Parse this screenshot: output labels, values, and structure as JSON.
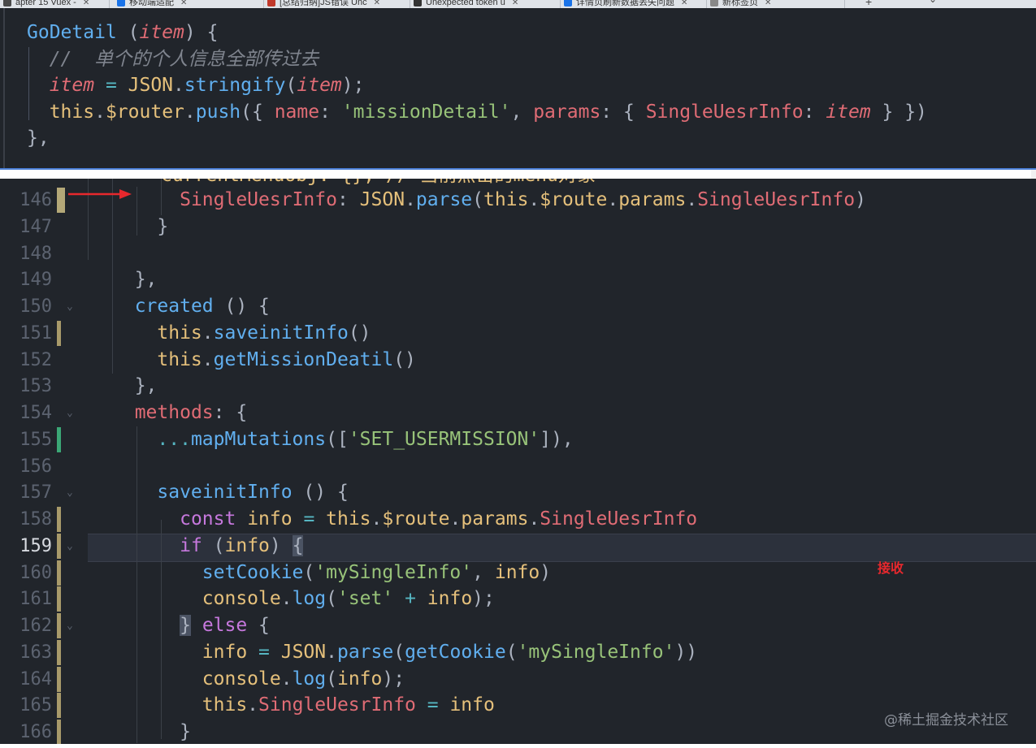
{
  "browser_tabs": [
    {
      "label": "apter 15 Vuex -",
      "color": "#4a4a4a"
    },
    {
      "label": "移动端适配",
      "color": "#1a73e8"
    },
    {
      "label": "[总结归纳]JS错误 Unc",
      "color": "#c0392b"
    },
    {
      "label": "Unexpected token u",
      "color": "#333333"
    },
    {
      "label": "详情页刷新数据丢失问题",
      "color": "#1a73e8"
    },
    {
      "label": "新标签页",
      "color": "#888888"
    }
  ],
  "top_snippet": {
    "lines": [
      [
        {
          "t": "GoDetail",
          "c": "f"
        },
        {
          "t": " (",
          "c": "t"
        },
        {
          "t": "item",
          "c": "pi"
        },
        {
          "t": ") {",
          "c": "t"
        }
      ],
      [
        {
          "t": "  //  单个的个人信息全部传过去",
          "c": "c"
        }
      ],
      [
        {
          "t": "  ",
          "c": "t"
        },
        {
          "t": "item",
          "c": "pi"
        },
        {
          "t": " = ",
          "c": "o"
        },
        {
          "t": "JSON",
          "c": "y"
        },
        {
          "t": ".",
          "c": "t"
        },
        {
          "t": "stringify",
          "c": "f"
        },
        {
          "t": "(",
          "c": "t"
        },
        {
          "t": "item",
          "c": "pi"
        },
        {
          "t": ");",
          "c": "t"
        }
      ],
      [
        {
          "t": "  ",
          "c": "t"
        },
        {
          "t": "this",
          "c": "y"
        },
        {
          "t": ".",
          "c": "t"
        },
        {
          "t": "$router",
          "c": "y"
        },
        {
          "t": ".",
          "c": "t"
        },
        {
          "t": "push",
          "c": "f"
        },
        {
          "t": "({ ",
          "c": "t"
        },
        {
          "t": "name",
          "c": "p"
        },
        {
          "t": ": ",
          "c": "t"
        },
        {
          "t": "'missionDetail'",
          "c": "s"
        },
        {
          "t": ", ",
          "c": "t"
        },
        {
          "t": "params",
          "c": "p"
        },
        {
          "t": ": { ",
          "c": "t"
        },
        {
          "t": "SingleUesrInfo",
          "c": "p"
        },
        {
          "t": ": ",
          "c": "t"
        },
        {
          "t": "item",
          "c": "pi"
        },
        {
          "t": " } })",
          "c": "t"
        }
      ],
      [
        {
          "t": "},",
          "c": "t"
        }
      ]
    ]
  },
  "cut_off_line": "currentMenuobj: {}, // 当前点击的menu对象",
  "editor": {
    "lines": [
      {
        "num": "146",
        "marker": "big",
        "fold": false,
        "active": false,
        "segments": [
          {
            "t": "      ",
            "c": "t"
          },
          {
            "t": "SingleUesrInfo",
            "c": "p"
          },
          {
            "t": ": ",
            "c": "t"
          },
          {
            "t": "JSON",
            "c": "y"
          },
          {
            "t": ".",
            "c": "t"
          },
          {
            "t": "parse",
            "c": "f"
          },
          {
            "t": "(",
            "c": "t"
          },
          {
            "t": "this",
            "c": "y"
          },
          {
            "t": ".",
            "c": "t"
          },
          {
            "t": "$route",
            "c": "y"
          },
          {
            "t": ".",
            "c": "t"
          },
          {
            "t": "params",
            "c": "y"
          },
          {
            "t": ".",
            "c": "t"
          },
          {
            "t": "SingleUesrInfo",
            "c": "p"
          },
          {
            "t": ")",
            "c": "t"
          }
        ]
      },
      {
        "num": "147",
        "marker": "",
        "fold": false,
        "active": false,
        "segments": [
          {
            "t": "    }",
            "c": "t"
          }
        ]
      },
      {
        "num": "148",
        "marker": "",
        "fold": false,
        "active": false,
        "segments": []
      },
      {
        "num": "149",
        "marker": "",
        "fold": false,
        "active": false,
        "segments": [
          {
            "t": "  },",
            "c": "t"
          }
        ]
      },
      {
        "num": "150",
        "marker": "",
        "fold": true,
        "active": false,
        "segments": [
          {
            "t": "  ",
            "c": "t"
          },
          {
            "t": "created",
            "c": "f"
          },
          {
            "t": " () {",
            "c": "t"
          }
        ]
      },
      {
        "num": "151",
        "marker": "mod",
        "fold": false,
        "active": false,
        "segments": [
          {
            "t": "    ",
            "c": "t"
          },
          {
            "t": "this",
            "c": "y"
          },
          {
            "t": ".",
            "c": "t"
          },
          {
            "t": "saveinitInfo",
            "c": "f"
          },
          {
            "t": "()",
            "c": "t"
          }
        ]
      },
      {
        "num": "152",
        "marker": "",
        "fold": false,
        "active": false,
        "segments": [
          {
            "t": "    ",
            "c": "t"
          },
          {
            "t": "this",
            "c": "y"
          },
          {
            "t": ".",
            "c": "t"
          },
          {
            "t": "getMissionDeatil",
            "c": "f"
          },
          {
            "t": "()",
            "c": "t"
          }
        ]
      },
      {
        "num": "153",
        "marker": "",
        "fold": false,
        "active": false,
        "segments": [
          {
            "t": "  },",
            "c": "t"
          }
        ]
      },
      {
        "num": "154",
        "marker": "",
        "fold": true,
        "active": false,
        "segments": [
          {
            "t": "  ",
            "c": "t"
          },
          {
            "t": "methods",
            "c": "p"
          },
          {
            "t": ": {",
            "c": "t"
          }
        ]
      },
      {
        "num": "155",
        "marker": "add",
        "fold": false,
        "active": false,
        "segments": [
          {
            "t": "    ",
            "c": "t"
          },
          {
            "t": "...",
            "c": "o"
          },
          {
            "t": "mapMutations",
            "c": "f"
          },
          {
            "t": "([",
            "c": "t"
          },
          {
            "t": "'SET_USERMISSION'",
            "c": "s"
          },
          {
            "t": "]),",
            "c": "t"
          }
        ]
      },
      {
        "num": "156",
        "marker": "",
        "fold": false,
        "active": false,
        "segments": []
      },
      {
        "num": "157",
        "marker": "",
        "fold": true,
        "active": false,
        "segments": [
          {
            "t": "    ",
            "c": "t"
          },
          {
            "t": "saveinitInfo",
            "c": "f"
          },
          {
            "t": " () {",
            "c": "t"
          }
        ]
      },
      {
        "num": "158",
        "marker": "mod",
        "fold": false,
        "active": false,
        "segments": [
          {
            "t": "      ",
            "c": "t"
          },
          {
            "t": "const",
            "c": "k"
          },
          {
            "t": " ",
            "c": "t"
          },
          {
            "t": "info",
            "c": "y"
          },
          {
            "t": " = ",
            "c": "o"
          },
          {
            "t": "this",
            "c": "y"
          },
          {
            "t": ".",
            "c": "t"
          },
          {
            "t": "$route",
            "c": "y"
          },
          {
            "t": ".",
            "c": "t"
          },
          {
            "t": "params",
            "c": "y"
          },
          {
            "t": ".",
            "c": "t"
          },
          {
            "t": "SingleUesrInfo",
            "c": "p"
          }
        ]
      },
      {
        "num": "159",
        "marker": "mod",
        "fold": true,
        "active": true,
        "segments": [
          {
            "t": "      ",
            "c": "t"
          },
          {
            "t": "if",
            "c": "k"
          },
          {
            "t": " (",
            "c": "t"
          },
          {
            "t": "info",
            "c": "y"
          },
          {
            "t": ") ",
            "c": "t"
          },
          {
            "t": "{",
            "c": "br"
          }
        ]
      },
      {
        "num": "160",
        "marker": "mod",
        "fold": false,
        "active": false,
        "segments": [
          {
            "t": "        ",
            "c": "t"
          },
          {
            "t": "setCookie",
            "c": "f"
          },
          {
            "t": "(",
            "c": "t"
          },
          {
            "t": "'mySingleInfo'",
            "c": "s"
          },
          {
            "t": ", ",
            "c": "t"
          },
          {
            "t": "info",
            "c": "y"
          },
          {
            "t": ")",
            "c": "t"
          }
        ]
      },
      {
        "num": "161",
        "marker": "mod",
        "fold": false,
        "active": false,
        "segments": [
          {
            "t": "        ",
            "c": "t"
          },
          {
            "t": "console",
            "c": "y"
          },
          {
            "t": ".",
            "c": "t"
          },
          {
            "t": "log",
            "c": "f"
          },
          {
            "t": "(",
            "c": "t"
          },
          {
            "t": "'set'",
            "c": "s"
          },
          {
            "t": " + ",
            "c": "o"
          },
          {
            "t": "info",
            "c": "y"
          },
          {
            "t": ");",
            "c": "t"
          }
        ]
      },
      {
        "num": "162",
        "marker": "mod",
        "fold": true,
        "active": false,
        "segments": [
          {
            "t": "      ",
            "c": "t"
          },
          {
            "t": "}",
            "c": "br"
          },
          {
            "t": " ",
            "c": "t"
          },
          {
            "t": "else",
            "c": "k"
          },
          {
            "t": " {",
            "c": "t"
          }
        ]
      },
      {
        "num": "163",
        "marker": "mod",
        "fold": false,
        "active": false,
        "segments": [
          {
            "t": "        ",
            "c": "t"
          },
          {
            "t": "info",
            "c": "y"
          },
          {
            "t": " = ",
            "c": "o"
          },
          {
            "t": "JSON",
            "c": "y"
          },
          {
            "t": ".",
            "c": "t"
          },
          {
            "t": "parse",
            "c": "f"
          },
          {
            "t": "(",
            "c": "t"
          },
          {
            "t": "getCookie",
            "c": "f"
          },
          {
            "t": "(",
            "c": "t"
          },
          {
            "t": "'mySingleInfo'",
            "c": "s"
          },
          {
            "t": "))",
            "c": "t"
          }
        ]
      },
      {
        "num": "164",
        "marker": "mod",
        "fold": false,
        "active": false,
        "segments": [
          {
            "t": "        ",
            "c": "t"
          },
          {
            "t": "console",
            "c": "y"
          },
          {
            "t": ".",
            "c": "t"
          },
          {
            "t": "log",
            "c": "f"
          },
          {
            "t": "(",
            "c": "t"
          },
          {
            "t": "info",
            "c": "y"
          },
          {
            "t": ");",
            "c": "t"
          }
        ]
      },
      {
        "num": "165",
        "marker": "mod",
        "fold": false,
        "active": false,
        "segments": [
          {
            "t": "        ",
            "c": "t"
          },
          {
            "t": "this",
            "c": "y"
          },
          {
            "t": ".",
            "c": "t"
          },
          {
            "t": "SingleUesrInfo",
            "c": "p"
          },
          {
            "t": " = ",
            "c": "o"
          },
          {
            "t": "info",
            "c": "y"
          }
        ]
      },
      {
        "num": "166",
        "marker": "mod",
        "fold": false,
        "active": false,
        "segments": [
          {
            "t": "      }",
            "c": "t"
          }
        ]
      }
    ]
  },
  "annotation": {
    "text": "接收",
    "color": "#e8282d"
  },
  "watermark": "@稀土掘金技术社区",
  "colors": {
    "editor_bg": "#21252b",
    "current_line_bg": "#2c313c",
    "accent_border": "#4b7fd6"
  }
}
